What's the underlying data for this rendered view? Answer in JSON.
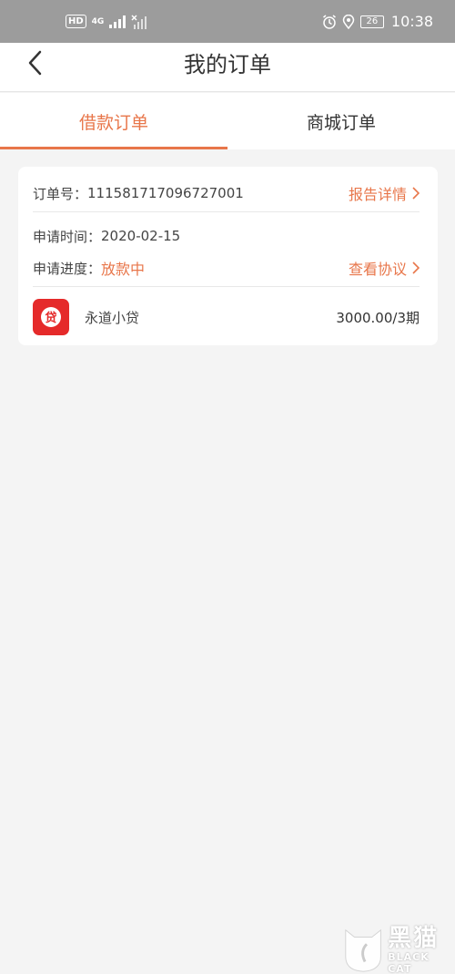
{
  "status_bar": {
    "hd": "HD",
    "network": "4G",
    "battery": "26",
    "time": "10:38"
  },
  "header": {
    "title": "我的订单"
  },
  "tabs": [
    {
      "label": "借款订单",
      "active": true
    },
    {
      "label": "商城订单",
      "active": false
    }
  ],
  "order": {
    "order_no_label": "订单号：",
    "order_no": "111581717096727001",
    "report_link": "报告详情",
    "apply_time_label": "申请时间：",
    "apply_time": "2020-02-15",
    "progress_label": "申请进度：",
    "progress": "放款中",
    "agreement_link": "查看协议",
    "product_icon_text": "贷",
    "product_name": "永道小贷",
    "amount": "3000.00/3期"
  },
  "watermark": {
    "top": "黑猫",
    "bottom": "BLACK CAT"
  },
  "colors": {
    "accent": "#e8764a",
    "status_bar": "#9c9c9c",
    "product_icon": "#e52a2a"
  }
}
